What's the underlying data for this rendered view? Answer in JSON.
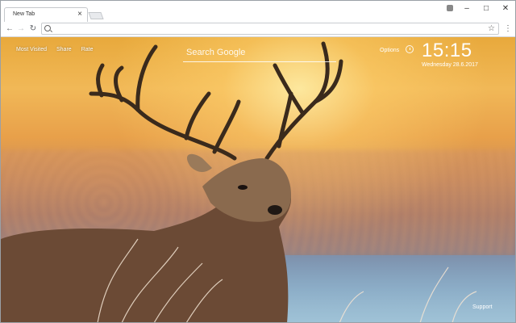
{
  "browser": {
    "tab_title": "New Tab",
    "tab_close": "×",
    "window_controls": {
      "minimize": "–",
      "maximize": "□",
      "close": "✕"
    },
    "nav": {
      "back": "←",
      "forward": "→",
      "reload": "↻"
    },
    "omnibox": {
      "value": ""
    },
    "star": "☆",
    "menu": "⋮"
  },
  "newtab": {
    "top_links": [
      "Most Visited",
      "Share",
      "Rate"
    ],
    "search_placeholder": "Search Google",
    "options_label": "Options",
    "clock_time": "15:15",
    "clock_date": "Wednesday  28.6.2017",
    "support_label": "Support"
  },
  "icons": {
    "profile": "profile-icon",
    "search": "search-icon",
    "star": "star-icon",
    "menu": "menu-icon",
    "clock": "clock-icon"
  }
}
